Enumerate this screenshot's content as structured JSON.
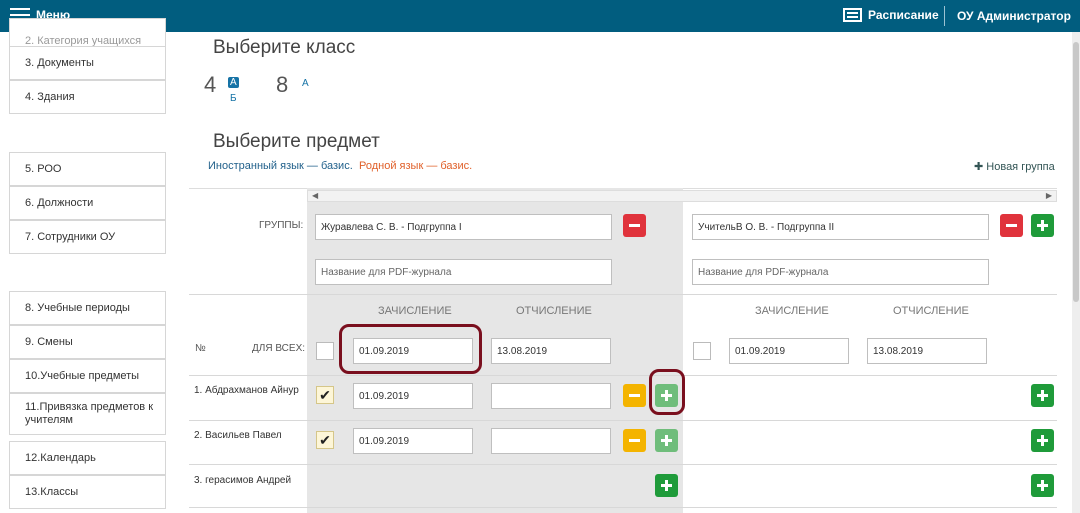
{
  "topbar": {
    "menu_label": "Меню",
    "schedule_label": "Расписание",
    "user_label": "ОУ Администратор"
  },
  "sidebar": {
    "items": [
      {
        "label": "2. Категория учащихся"
      },
      {
        "label": "3.  Документы"
      },
      {
        "label": "4.  Здания"
      },
      {
        "label": "5.  РОО"
      },
      {
        "label": "6.  Должности"
      },
      {
        "label": "7.  Сотрудники ОУ"
      },
      {
        "label": "8.  Учебные периоды"
      },
      {
        "label": "9.  Смены"
      },
      {
        "label": "10.Учебные предметы"
      },
      {
        "label": "11.Привязка предметов к учителям"
      },
      {
        "label": "12.Календарь"
      },
      {
        "label": "13.Классы"
      }
    ]
  },
  "class_select": {
    "title": "Выберите класс",
    "grades": [
      {
        "number": "4",
        "letters": [
          "А",
          "Б"
        ]
      },
      {
        "number": "8",
        "letters": [
          "А"
        ]
      }
    ]
  },
  "subject_select": {
    "title": "Выберите предмет",
    "subjects": [
      "Иностранный язык — базис.",
      "Родной язык — базис."
    ],
    "new_group_label": "Новая группа"
  },
  "table": {
    "groups_label": "ГРУППЫ:",
    "no_label": "№",
    "for_all_label": "ДЛЯ ВСЕХ:",
    "enroll_header": "ЗАЧИСЛЕНИЕ",
    "expel_header": "ОТЧИСЛЕНИЕ",
    "pdf_placeholder": "Название для PDF-журнала",
    "groups": [
      {
        "name": "Журавлева С. В. - Подгруппа I",
        "enroll_all": "01.09.2019",
        "expel_all": "13.08.2019"
      },
      {
        "name": "УчительВ О. В. - Подгруппа II",
        "enroll_all": "01.09.2019",
        "expel_all": "13.08.2019"
      }
    ],
    "students": [
      {
        "name": "1. Абдрахманов Айнур",
        "checked": "✔",
        "enroll": "01.09.2019",
        "expel": ""
      },
      {
        "name": "2. Васильев Павел",
        "checked": "✔",
        "enroll": "01.09.2019",
        "expel": ""
      },
      {
        "name": "3. герасимов Андрей",
        "checked": "",
        "enroll": "",
        "expel": ""
      }
    ]
  },
  "colors": {
    "topbar": "#015d7f",
    "accent": "#1673a6",
    "red": "#e0333c",
    "green": "#1f9b3a",
    "yellow": "#f4b400",
    "highlight": "#7a0f1e"
  }
}
